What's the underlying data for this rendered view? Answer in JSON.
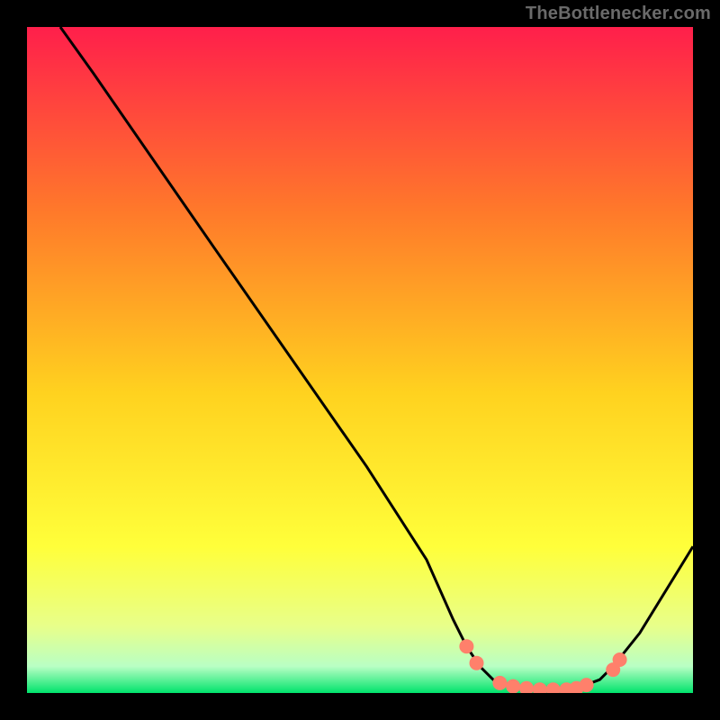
{
  "watermark": "TheBottlenecker.com",
  "colors": {
    "gradient_top": "#ff1f4b",
    "gradient_mid1": "#ff7a2a",
    "gradient_mid2": "#ffd21f",
    "gradient_mid3": "#ffff3a",
    "gradient_mid4": "#e8ff8a",
    "gradient_bottom1": "#b9ffc4",
    "gradient_bottom2": "#00e36b",
    "curve": "#000000",
    "markers": "#ff806b"
  },
  "chart_data": {
    "type": "line",
    "title": "",
    "xlabel": "",
    "ylabel": "",
    "xlim": [
      0,
      100
    ],
    "ylim": [
      0,
      100
    ],
    "curve": [
      {
        "x": 5,
        "y": 100
      },
      {
        "x": 10,
        "y": 93
      },
      {
        "x": 28,
        "y": 67
      },
      {
        "x": 51,
        "y": 34
      },
      {
        "x": 60,
        "y": 20
      },
      {
        "x": 64,
        "y": 11
      },
      {
        "x": 66,
        "y": 7
      },
      {
        "x": 68,
        "y": 4
      },
      {
        "x": 70,
        "y": 2
      },
      {
        "x": 73,
        "y": 1
      },
      {
        "x": 77,
        "y": 0.5
      },
      {
        "x": 82,
        "y": 0.5
      },
      {
        "x": 86,
        "y": 2
      },
      {
        "x": 88,
        "y": 4
      },
      {
        "x": 92,
        "y": 9
      },
      {
        "x": 100,
        "y": 22
      }
    ],
    "markers": [
      {
        "x": 66,
        "y": 7
      },
      {
        "x": 67.5,
        "y": 4.5
      },
      {
        "x": 71,
        "y": 1.5
      },
      {
        "x": 73,
        "y": 1
      },
      {
        "x": 75,
        "y": 0.7
      },
      {
        "x": 77,
        "y": 0.5
      },
      {
        "x": 79,
        "y": 0.5
      },
      {
        "x": 81,
        "y": 0.5
      },
      {
        "x": 82.5,
        "y": 0.7
      },
      {
        "x": 84,
        "y": 1.2
      },
      {
        "x": 88,
        "y": 3.5
      },
      {
        "x": 89,
        "y": 5
      }
    ]
  }
}
